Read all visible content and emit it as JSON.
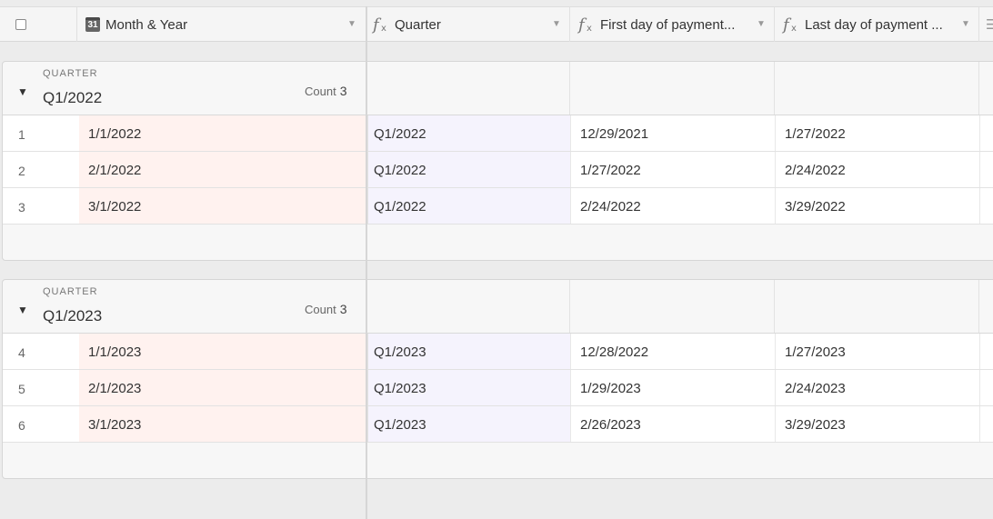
{
  "columns": {
    "month": {
      "label": "Month & Year",
      "icon": "calendar-icon",
      "icon_text": "31"
    },
    "quarter": {
      "label": "Quarter",
      "icon": "formula-icon"
    },
    "first": {
      "label": "First day of payment...",
      "icon": "formula-icon"
    },
    "last": {
      "label": "Last day of payment ...",
      "icon": "formula-icon"
    }
  },
  "groups": [
    {
      "field": "QUARTER",
      "value": "Q1/2022",
      "count_label": "Count",
      "count": "3",
      "rows": [
        {
          "num": "1",
          "month": "1/1/2022",
          "quarter": "Q1/2022",
          "first": "12/29/2021",
          "last": "1/27/2022"
        },
        {
          "num": "2",
          "month": "2/1/2022",
          "quarter": "Q1/2022",
          "first": "1/27/2022",
          "last": "2/24/2022"
        },
        {
          "num": "3",
          "month": "3/1/2022",
          "quarter": "Q1/2022",
          "first": "2/24/2022",
          "last": "3/29/2022"
        }
      ]
    },
    {
      "field": "QUARTER",
      "value": "Q1/2023",
      "count_label": "Count",
      "count": "3",
      "rows": [
        {
          "num": "4",
          "month": "1/1/2023",
          "quarter": "Q1/2023",
          "first": "12/28/2022",
          "last": "1/27/2023"
        },
        {
          "num": "5",
          "month": "2/1/2023",
          "quarter": "Q1/2023",
          "first": "1/29/2023",
          "last": "2/24/2023"
        },
        {
          "num": "6",
          "month": "3/1/2023",
          "quarter": "Q1/2023",
          "first": "2/26/2023",
          "last": "3/29/2023"
        }
      ]
    }
  ],
  "colors": {
    "month_column_bg": "#fff2ef",
    "quarter_column_bg": "#f5f3fd",
    "background": "#ececec"
  }
}
